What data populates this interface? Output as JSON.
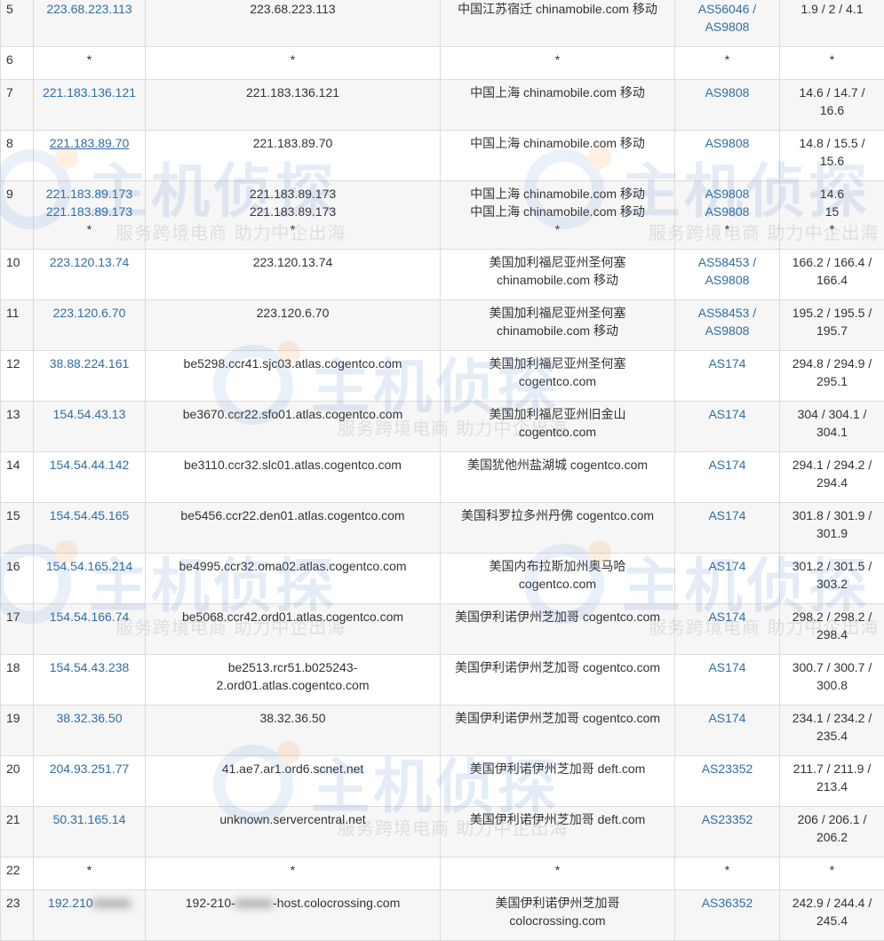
{
  "watermark": {
    "title": "主机侦探",
    "slogan": "服务跨境电商 助力中企出海"
  },
  "rows": [
    {
      "hop": "5",
      "ip": [
        "223.68.223.113"
      ],
      "host": [
        "223.68.223.113"
      ],
      "loc": [
        "中国江苏宿迁 chinamobile.com 移动"
      ],
      "asn": [
        "AS56046 /",
        "AS9808"
      ],
      "time": [
        "1.9 / 2 / 4.1"
      ],
      "h": 57
    },
    {
      "hop": "6",
      "ip": [
        "*"
      ],
      "host": [
        "*"
      ],
      "loc": [
        "*"
      ],
      "asn": [
        "*"
      ],
      "time": [
        "*"
      ],
      "h": 37
    },
    {
      "hop": "7",
      "ip": [
        "221.183.136.121"
      ],
      "host": [
        "221.183.136.121"
      ],
      "loc": [
        "中国上海 chinamobile.com 移动"
      ],
      "asn": [
        "AS9808"
      ],
      "time": [
        "14.6 / 14.7 /",
        "16.6"
      ],
      "h": 57
    },
    {
      "hop": "8",
      "ip": [
        "221.183.89.70"
      ],
      "host": [
        "221.183.89.70"
      ],
      "loc": [
        "中国上海 chinamobile.com 移动"
      ],
      "asn": [
        "AS9808"
      ],
      "time": [
        "14.8 / 15.5 /",
        "15.6"
      ],
      "h": 57,
      "ipUnderline": true
    },
    {
      "hop": "9",
      "ip": [
        "221.183.89.173",
        "221.183.89.173",
        "*"
      ],
      "host": [
        "221.183.89.173",
        "221.183.89.173",
        "*"
      ],
      "loc": [
        "中国上海 chinamobile.com 移动",
        "中国上海 chinamobile.com 移动",
        "*"
      ],
      "asn": [
        "AS9808",
        "AS9808",
        "*"
      ],
      "time": [
        "14.6",
        "15",
        "*"
      ],
      "h": 77
    },
    {
      "hop": "10",
      "ip": [
        "223.120.13.74"
      ],
      "host": [
        "223.120.13.74"
      ],
      "loc": [
        "美国加利福尼亚州圣何塞",
        "chinamobile.com 移动"
      ],
      "asn": [
        "AS58453 /",
        "AS9808"
      ],
      "time": [
        "166.2 / 166.4 /",
        "166.4"
      ],
      "h": 57
    },
    {
      "hop": "11",
      "ip": [
        "223.120.6.70"
      ],
      "host": [
        "223.120.6.70"
      ],
      "loc": [
        "美国加利福尼亚州圣何塞",
        "chinamobile.com 移动"
      ],
      "asn": [
        "AS58453 /",
        "AS9808"
      ],
      "time": [
        "195.2 / 195.5 /",
        "195.7"
      ],
      "h": 57
    },
    {
      "hop": "12",
      "ip": [
        "38.88.224.161"
      ],
      "host": [
        "be5298.ccr41.sjc03.atlas.cogentco.com"
      ],
      "loc": [
        "美国加利福尼亚州圣何塞",
        "cogentco.com"
      ],
      "asn": [
        "AS174"
      ],
      "time": [
        "294.8 / 294.9 /",
        "295.1"
      ],
      "h": 57
    },
    {
      "hop": "13",
      "ip": [
        "154.54.43.13"
      ],
      "host": [
        "be3670.ccr22.sfo01.atlas.cogentco.com"
      ],
      "loc": [
        "美国加利福尼亚州旧金山",
        "cogentco.com"
      ],
      "asn": [
        "AS174"
      ],
      "time": [
        "304 / 304.1 /",
        "304.1"
      ],
      "h": 57
    },
    {
      "hop": "14",
      "ip": [
        "154.54.44.142"
      ],
      "host": [
        "be3110.ccr32.slc01.atlas.cogentco.com"
      ],
      "loc": [
        "美国犹他州盐湖城 cogentco.com"
      ],
      "asn": [
        "AS174"
      ],
      "time": [
        "294.1 / 294.2 /",
        "294.4"
      ],
      "h": 57
    },
    {
      "hop": "15",
      "ip": [
        "154.54.45.165"
      ],
      "host": [
        "be5456.ccr22.den01.atlas.cogentco.com"
      ],
      "loc": [
        "美国科罗拉多州丹佛 cogentco.com"
      ],
      "asn": [
        "AS174"
      ],
      "time": [
        "301.8 / 301.9 /",
        "301.9"
      ],
      "h": 57
    },
    {
      "hop": "16",
      "ip": [
        "154.54.165.214"
      ],
      "host": [
        "be4995.ccr32.oma02.atlas.cogentco.com"
      ],
      "loc": [
        "美国内布拉斯加州奥马哈",
        "cogentco.com"
      ],
      "asn": [
        "AS174"
      ],
      "time": [
        "301.2 / 301.5 /",
        "303.2"
      ],
      "h": 57
    },
    {
      "hop": "17",
      "ip": [
        "154.54.166.74"
      ],
      "host": [
        "be5068.ccr42.ord01.atlas.cogentco.com"
      ],
      "loc": [
        "美国伊利诺伊州芝加哥 cogentco.com"
      ],
      "asn": [
        "AS174"
      ],
      "time": [
        "298.2 / 298.2 /",
        "298.4"
      ],
      "h": 57
    },
    {
      "hop": "18",
      "ip": [
        "154.54.43.238"
      ],
      "host": [
        "be2513.rcr51.b025243-",
        "2.ord01.atlas.cogentco.com"
      ],
      "loc": [
        "美国伊利诺伊州芝加哥 cogentco.com"
      ],
      "asn": [
        "AS174"
      ],
      "time": [
        "300.7 / 300.7 /",
        "300.8"
      ],
      "h": 57
    },
    {
      "hop": "19",
      "ip": [
        "38.32.36.50"
      ],
      "host": [
        "38.32.36.50"
      ],
      "loc": [
        "美国伊利诺伊州芝加哥 cogentco.com"
      ],
      "asn": [
        "AS174"
      ],
      "time": [
        "234.1 / 234.2 /",
        "235.4"
      ],
      "h": 57
    },
    {
      "hop": "20",
      "ip": [
        "204.93.251.77"
      ],
      "host": [
        "41.ae7.ar1.ord6.scnet.net"
      ],
      "loc": [
        "美国伊利诺伊州芝加哥 deft.com"
      ],
      "asn": [
        "AS23352"
      ],
      "time": [
        "211.7 / 211.9 /",
        "213.4"
      ],
      "h": 57
    },
    {
      "hop": "21",
      "ip": [
        "50.31.165.14"
      ],
      "host": [
        "unknown.servercentral.net"
      ],
      "loc": [
        "美国伊利诺伊州芝加哥 deft.com"
      ],
      "asn": [
        "AS23352"
      ],
      "time": [
        "206 / 206.1 /",
        "206.2"
      ],
      "h": 57
    },
    {
      "hop": "22",
      "ip": [
        "*"
      ],
      "host": [
        "*"
      ],
      "loc": [
        "*"
      ],
      "asn": [
        "*"
      ],
      "time": [
        "*"
      ],
      "h": 37
    },
    {
      "hop": "23",
      "ip": [
        "192.210"
      ],
      "ipBlur": "■■■■■",
      "host": [
        "192-210-"
      ],
      "hostBlur": "■■■■■",
      "hostTail": "-host.colocrossing.com",
      "loc": [
        "美国伊利诺伊州芝加哥",
        "colocrossing.com"
      ],
      "asn": [
        "AS36352"
      ],
      "time": [
        "242.9 / 244.4 /",
        "245.4"
      ],
      "h": 57
    }
  ]
}
